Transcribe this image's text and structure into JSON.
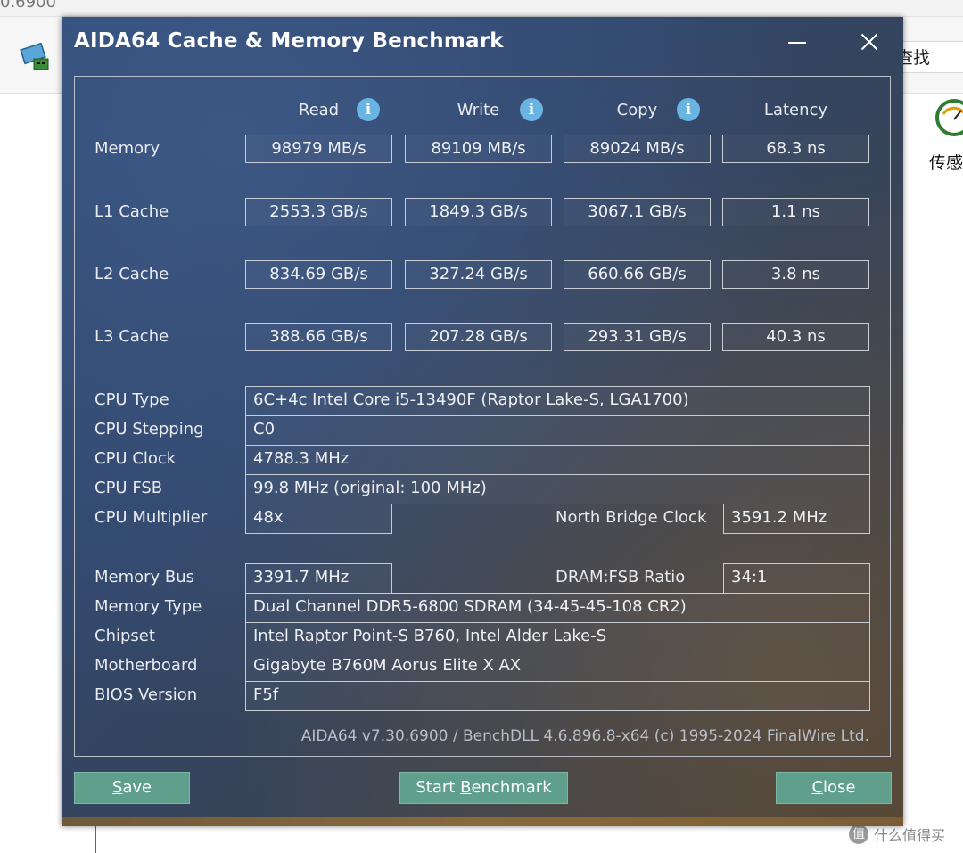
{
  "background": {
    "top_fragment": "0.6900",
    "search_label": "查找",
    "sensor_label": "传感",
    "watermark": "什么值得买",
    "watermark_icon": "值"
  },
  "dialog": {
    "title": "AIDA64 Cache & Memory Benchmark",
    "columns": {
      "read": "Read",
      "write": "Write",
      "copy": "Copy",
      "latency": "Latency"
    },
    "info_glyph": "i",
    "rows": [
      {
        "label": "Memory",
        "read": "98979 MB/s",
        "write": "89109 MB/s",
        "copy": "89024 MB/s",
        "latency": "68.3 ns"
      },
      {
        "label": "L1 Cache",
        "read": "2553.3 GB/s",
        "write": "1849.3 GB/s",
        "copy": "3067.1 GB/s",
        "latency": "1.1 ns"
      },
      {
        "label": "L2 Cache",
        "read": "834.69 GB/s",
        "write": "327.24 GB/s",
        "copy": "660.66 GB/s",
        "latency": "3.8 ns"
      },
      {
        "label": "L3 Cache",
        "read": "388.66 GB/s",
        "write": "207.28 GB/s",
        "copy": "293.31 GB/s",
        "latency": "40.3 ns"
      }
    ],
    "cpu": {
      "type_label": "CPU Type",
      "type": "6C+4c Intel Core i5-13490F  (Raptor Lake-S, LGA1700)",
      "stepping_label": "CPU Stepping",
      "stepping": "C0",
      "clock_label": "CPU Clock",
      "clock": "4788.3 MHz",
      "fsb_label": "CPU FSB",
      "fsb": "99.8 MHz  (original: 100 MHz)",
      "multiplier_label": "CPU Multiplier",
      "multiplier": "48x",
      "nb_clock_label": "North Bridge Clock",
      "nb_clock": "3591.2 MHz"
    },
    "mem": {
      "bus_label": "Memory Bus",
      "bus": "3391.7 MHz",
      "dram_ratio_label": "DRAM:FSB Ratio",
      "dram_ratio": "34:1",
      "type_label": "Memory Type",
      "type": "Dual Channel DDR5-6800 SDRAM  (34-45-45-108 CR2)",
      "chipset_label": "Chipset",
      "chipset": "Intel Raptor Point-S B760, Intel Alder Lake-S",
      "motherboard_label": "Motherboard",
      "motherboard": "Gigabyte B760M Aorus Elite X AX",
      "bios_label": "BIOS Version",
      "bios": "F5f"
    },
    "footer": "AIDA64 v7.30.6900 / BenchDLL 4.6.896.8-x64  (c) 1995-2024 FinalWire Ltd.",
    "buttons": {
      "save_mnemonic": "S",
      "save_rest": "ave",
      "start_pre": "Start ",
      "start_mnemonic": "B",
      "start_rest": "enchmark",
      "close_mnemonic": "C",
      "close_rest": "lose"
    }
  }
}
